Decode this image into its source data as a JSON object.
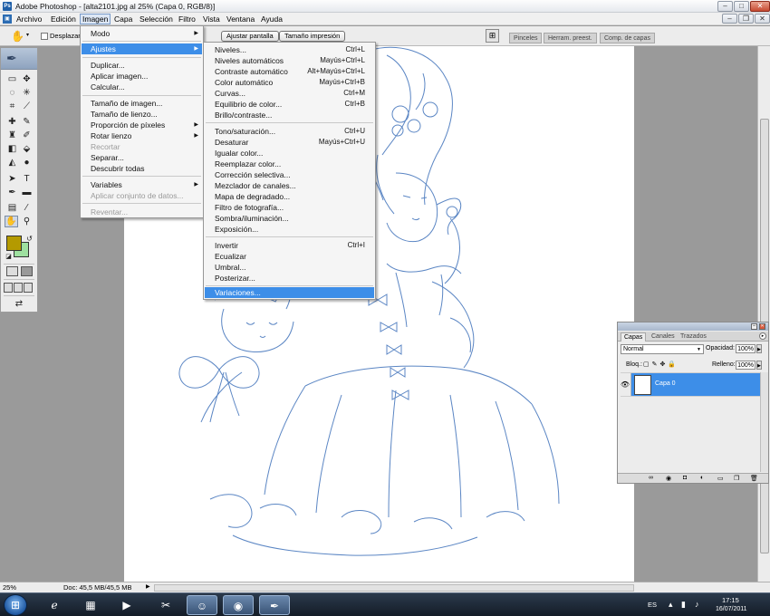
{
  "window": {
    "title": "Adobe Photoshop - [alta2101.jpg al 25% (Capa 0, RGB/8)]",
    "icon": "Ps"
  },
  "menubar": {
    "items": [
      "Archivo",
      "Edición",
      "Imagen",
      "Capa",
      "Selección",
      "Filtro",
      "Vista",
      "Ventana",
      "Ayuda"
    ],
    "active": "Imagen"
  },
  "options": {
    "tool_caret": "▾",
    "checkbox_label": "Desplazarse",
    "buttons": [
      "Ajustar pantalla",
      "Tamaño impresión"
    ],
    "dock_tabs": [
      "Pinceles",
      "Herram. preest.",
      "Comp. de capas"
    ]
  },
  "imagen_menu": {
    "items": [
      {
        "label": "Modo",
        "submenu": true
      },
      {
        "label": "Ajustes",
        "submenu": true,
        "highlighted": true
      },
      {
        "label": "Duplicar..."
      },
      {
        "label": "Aplicar imagen..."
      },
      {
        "label": "Calcular..."
      },
      {
        "label": "Tamaño de imagen..."
      },
      {
        "label": "Tamaño de lienzo..."
      },
      {
        "label": "Proporción de píxeles",
        "submenu": true
      },
      {
        "label": "Rotar lienzo",
        "submenu": true
      },
      {
        "label": "Recortar",
        "disabled": true
      },
      {
        "label": "Separar..."
      },
      {
        "label": "Descubrir todas"
      },
      {
        "label": "Variables",
        "submenu": true
      },
      {
        "label": "Aplicar conjunto de datos...",
        "disabled": true
      },
      {
        "label": "Reventar...",
        "disabled": true
      }
    ]
  },
  "ajustes_submenu": {
    "items": [
      {
        "label": "Niveles...",
        "shortcut": "Ctrl+L"
      },
      {
        "label": "Niveles automáticos",
        "shortcut": "Mayús+Ctrl+L"
      },
      {
        "label": "Contraste automático",
        "shortcut": "Alt+Mayús+Ctrl+L"
      },
      {
        "label": "Color automático",
        "shortcut": "Mayús+Ctrl+B"
      },
      {
        "label": "Curvas...",
        "shortcut": "Ctrl+M"
      },
      {
        "label": "Equilibrio de color...",
        "shortcut": "Ctrl+B"
      },
      {
        "label": "Brillo/contraste...",
        "shortcut": ""
      },
      {
        "label": "Tono/saturación...",
        "shortcut": "Ctrl+U"
      },
      {
        "label": "Desaturar",
        "shortcut": "Mayús+Ctrl+U"
      },
      {
        "label": "Igualar color...",
        "shortcut": ""
      },
      {
        "label": "Reemplazar color...",
        "shortcut": ""
      },
      {
        "label": "Corrección selectiva...",
        "shortcut": ""
      },
      {
        "label": "Mezclador de canales...",
        "shortcut": ""
      },
      {
        "label": "Mapa de degradado...",
        "shortcut": ""
      },
      {
        "label": "Filtro de fotografía...",
        "shortcut": ""
      },
      {
        "label": "Sombra/iluminación...",
        "shortcut": ""
      },
      {
        "label": "Exposición...",
        "shortcut": ""
      },
      {
        "label": "Invertir",
        "shortcut": "Ctrl+I"
      },
      {
        "label": "Ecualizar",
        "shortcut": ""
      },
      {
        "label": "Umbral...",
        "shortcut": ""
      },
      {
        "label": "Posterizar...",
        "shortcut": ""
      },
      {
        "label": "Variaciones...",
        "shortcut": "",
        "highlighted": true
      }
    ]
  },
  "colors": {
    "foreground": "#b49a00",
    "background": "#9ee0a0",
    "highlight": "#3d8ee8",
    "sketch_line": "#5b86c4"
  },
  "layers_panel": {
    "tabs": [
      "Capas",
      "Canales",
      "Trazados"
    ],
    "active_tab": "Capas",
    "blend_mode": "Normal",
    "opacity_label": "Opacidad:",
    "opacity": "100%",
    "lock_label": "Bloq.:",
    "fill_label": "Relleno:",
    "fill": "100%",
    "layer_name": "Capa 0",
    "bottom_icons": [
      "link-icon",
      "fx-icon",
      "mask-icon",
      "adjustment-icon",
      "folder-icon",
      "new-layer-icon",
      "trash-icon"
    ]
  },
  "statusbar": {
    "zoom": "25%",
    "doc": "Doc: 45,5 MB/45,5 MB"
  },
  "taskbar": {
    "lang": "ES",
    "time": "17:15",
    "date": "16/07/2011",
    "apps": [
      "ie-icon",
      "explorer-icon",
      "media-icon",
      "tool-icon",
      "messenger-icon",
      "chrome-icon",
      "photoshop-icon"
    ]
  }
}
